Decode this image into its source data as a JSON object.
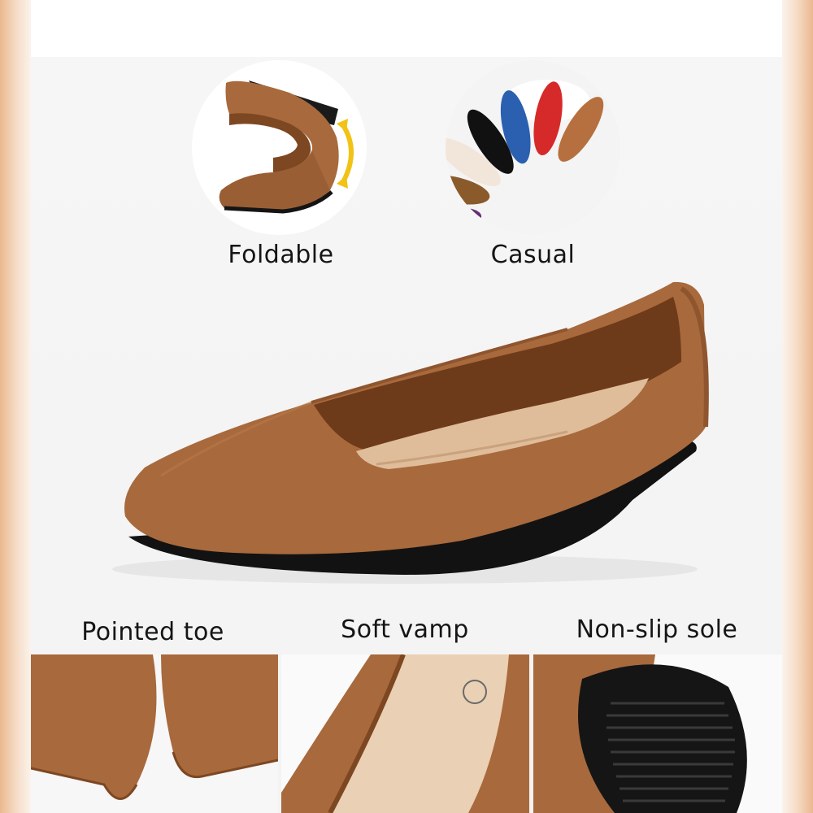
{
  "features": {
    "foldable": "Foldable",
    "casual": "Casual",
    "pointed_toe": "Pointed toe",
    "soft_vamp": "Soft vamp",
    "non_slip_sole": "Non-slip sole"
  },
  "colors": {
    "suede": "#a8693c",
    "suede_dark": "#7d4722",
    "lining": "#e0bd9a",
    "sole": "#141414",
    "fold_arrow": "#f2c214"
  }
}
